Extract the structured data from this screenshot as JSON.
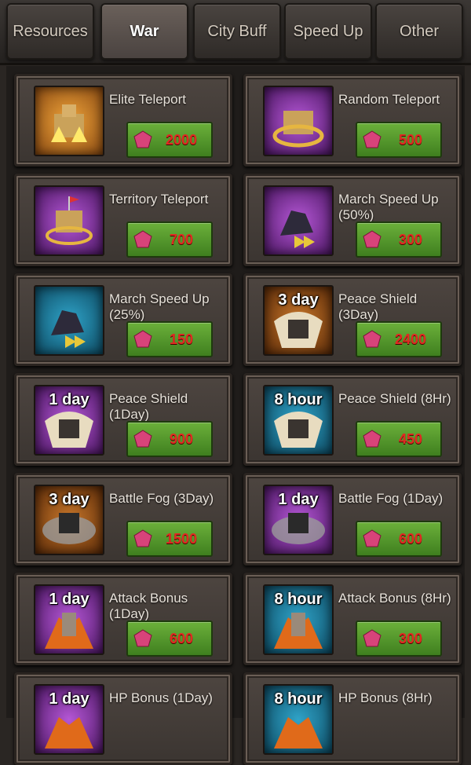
{
  "tabs": [
    {
      "label": "Resources"
    },
    {
      "label": "War",
      "active": true
    },
    {
      "label": "City Buff"
    },
    {
      "label": "Speed Up"
    },
    {
      "label": "Other"
    }
  ],
  "items": [
    {
      "name": "Elite Teleport",
      "price": "2000",
      "icon": "castle-teleport-icon"
    },
    {
      "name": "Random Teleport",
      "price": "500",
      "icon": "castle-teleport-icon"
    },
    {
      "name": "Territory Teleport",
      "price": "700",
      "icon": "castle-teleport-icon"
    },
    {
      "name": "March Speed Up (50%)",
      "price": "300",
      "icon": "knight-speed-icon"
    },
    {
      "name": "March Speed Up (25%)",
      "price": "150",
      "icon": "knight-speed-icon"
    },
    {
      "name": "Peace Shield (3Day)",
      "price": "2400",
      "icon": "shield-icon",
      "timer": "3 day"
    },
    {
      "name": "Peace Shield (1Day)",
      "price": "900",
      "icon": "shield-icon",
      "timer": "1 day"
    },
    {
      "name": "Peace Shield (8Hr)",
      "price": "450",
      "icon": "shield-icon",
      "timer": "8 hour"
    },
    {
      "name": "Battle Fog (3Day)",
      "price": "1500",
      "icon": "fog-icon",
      "timer": "3 day"
    },
    {
      "name": "Battle Fog (1Day)",
      "price": "600",
      "icon": "fog-icon",
      "timer": "1 day"
    },
    {
      "name": "Attack Bonus (1Day)",
      "price": "600",
      "icon": "warrior-icon",
      "timer": "1 day"
    },
    {
      "name": "Attack Bonus (8Hr)",
      "price": "300",
      "icon": "warrior-icon",
      "timer": "8 hour"
    },
    {
      "name": "HP Bonus (1Day)",
      "price": "",
      "icon": "warrior-icon",
      "timer": "1 day"
    },
    {
      "name": "HP Bonus (8Hr)",
      "price": "",
      "icon": "warrior-icon",
      "timer": "8 hour"
    }
  ],
  "colors": {
    "button_green": "#5a9e2f",
    "price_red": "#e02a22",
    "gem": "#d8437a"
  }
}
